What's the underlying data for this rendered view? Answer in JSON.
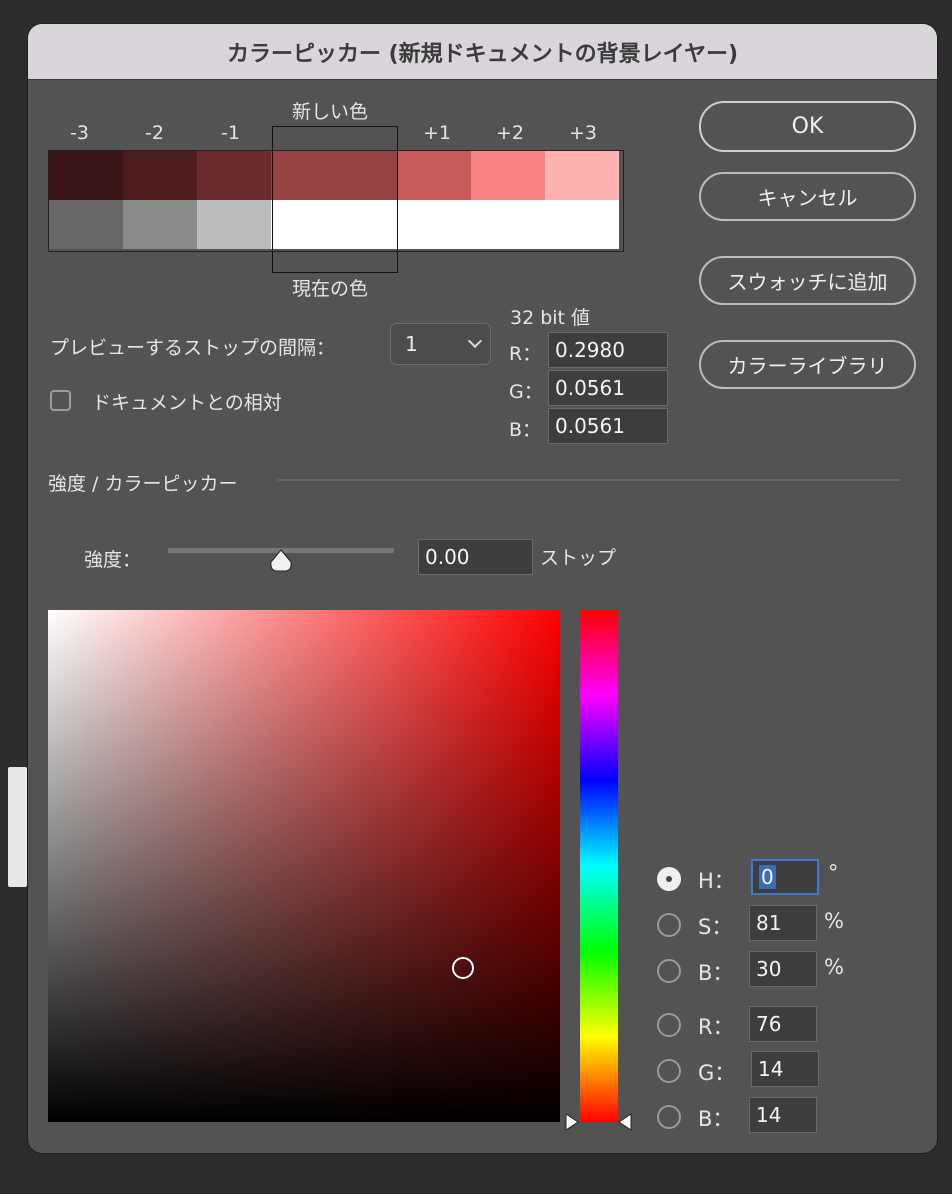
{
  "window": {
    "title": "カラーピッカー (新規ドキュメントの背景レイヤー)"
  },
  "swatches": {
    "new_label": "新しい色",
    "current_label": "現在の色",
    "stop_labels": [
      "-3",
      "-2",
      "-1",
      "+1",
      "+2",
      "+3"
    ],
    "new_colors": [
      "#3a1517",
      "#4e1d20",
      "#6a2b2d",
      "#964443",
      "#c85a5a",
      "#f98583",
      "#feb3b1"
    ],
    "current_colors": [
      "#666666",
      "#8a8a8a",
      "#bcbcbc",
      "#ffffff",
      "#ffffff",
      "#ffffff",
      "#ffffff"
    ]
  },
  "buttons": {
    "ok": "OK",
    "cancel": "キャンセル",
    "add_swatch": "スウォッチに追加",
    "color_libraries": "カラーライブラリ"
  },
  "preview": {
    "label": "プレビューするストップの間隔：",
    "value": "1"
  },
  "relative": {
    "label": "ドキュメントとの相対",
    "checked": false
  },
  "bit32": {
    "title": "32 bit 値",
    "fields": [
      {
        "label": "R：",
        "value": "0.2980"
      },
      {
        "label": "G：",
        "value": "0.0561"
      },
      {
        "label": "B：",
        "value": "0.0561"
      }
    ]
  },
  "section": {
    "title": "強度 / カラーピッカー"
  },
  "intensity": {
    "label": "強度：",
    "value": "0.00",
    "unit": "ストップ",
    "slider_level": 0.5
  },
  "picker": {
    "hue_deg": 0,
    "saturation_pct": 81,
    "brightness_pct": 30
  },
  "channels": {
    "h": {
      "label": "H：",
      "value": "0",
      "unit": "°",
      "selected": true
    },
    "s": {
      "label": "S：",
      "value": "81",
      "unit": "%"
    },
    "b": {
      "label": "B：",
      "value": "30",
      "unit": "%"
    },
    "r": {
      "label": "R：",
      "value": "76"
    },
    "g": {
      "label": "G：",
      "value": "14"
    },
    "bb": {
      "label": "B：",
      "value": "14"
    }
  }
}
